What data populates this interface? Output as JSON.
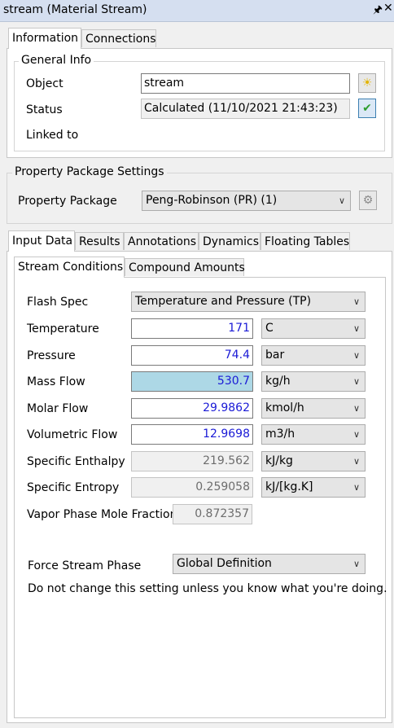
{
  "window": {
    "title": "stream (Material Stream)",
    "pin_icon": "pin-icon",
    "close_icon": "close-icon"
  },
  "top_tabs": [
    "Information",
    "Connections"
  ],
  "general_info": {
    "legend": "General Info",
    "object_label": "Object",
    "object_value": "stream",
    "status_label": "Status",
    "status_value": "Calculated (11/10/2021 21:43:23)",
    "linked_label": "Linked to"
  },
  "property_package": {
    "legend": "Property Package Settings",
    "label": "Property Package",
    "value": "Peng-Robinson (PR) (1)"
  },
  "data_tabs": [
    "Input Data",
    "Results",
    "Annotations",
    "Dynamics",
    "Floating Tables"
  ],
  "sub_tabs": [
    "Stream Conditions",
    "Compound Amounts"
  ],
  "conditions": {
    "flash_spec_label": "Flash Spec",
    "flash_spec_value": "Temperature and Pressure (TP)",
    "rows": [
      {
        "label": "Temperature",
        "value": "171",
        "unit": "C"
      },
      {
        "label": "Pressure",
        "value": "74.4",
        "unit": "bar"
      },
      {
        "label": "Mass Flow",
        "value": "530.7",
        "unit": "kg/h"
      },
      {
        "label": "Molar Flow",
        "value": "29.9862",
        "unit": "kmol/h"
      },
      {
        "label": "Volumetric Flow",
        "value": "12.9698",
        "unit": "m3/h"
      },
      {
        "label": "Specific Enthalpy",
        "value": "219.562",
        "unit": "kJ/kg"
      },
      {
        "label": "Specific Entropy",
        "value": "0.259058",
        "unit": "kJ/[kg.K]"
      }
    ],
    "vapor_label": "Vapor Phase Mole Fraction",
    "vapor_value": "0.872357",
    "force_phase_label": "Force Stream Phase",
    "force_phase_value": "Global Definition",
    "warning": "Do not change this setting unless you know what you're doing."
  },
  "colors": {
    "titlebar": "#d5dff0",
    "highlight": "#add8e6",
    "value_text": "#1a1ad6",
    "ok_check": "#2e9e2e"
  }
}
